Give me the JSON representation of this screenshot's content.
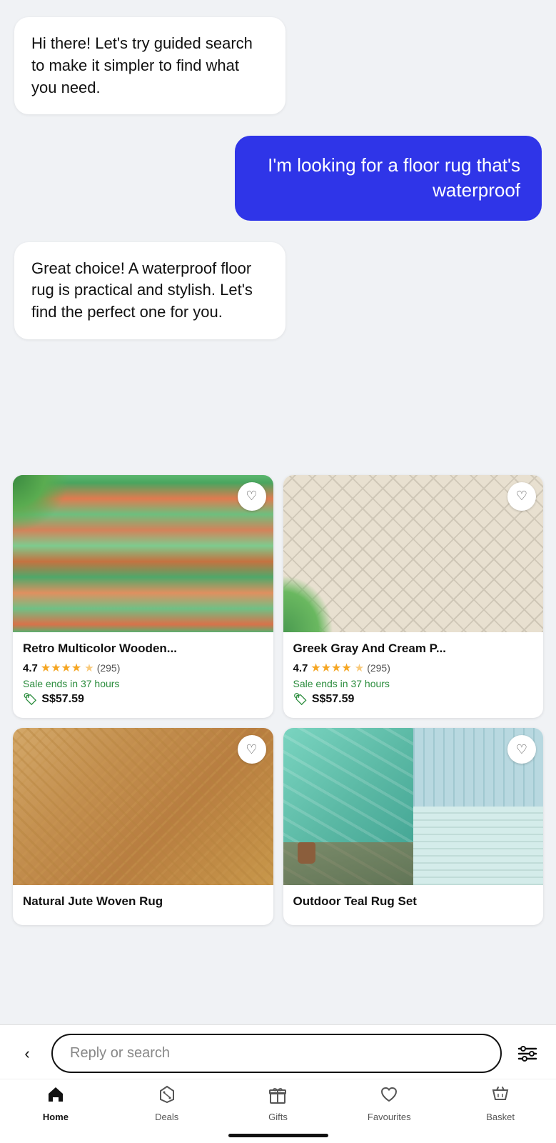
{
  "chat": {
    "bot_greeting": "Hi there! Let's try guided search to make it simpler to find what you need.",
    "user_message": "I'm looking for a floor rug that's waterproof",
    "bot_response": "Great choice! A waterproof floor rug is practical and stylish. Let's find the perfect one for you."
  },
  "products": [
    {
      "id": 1,
      "name": "Retro Multicolor Wooden...",
      "rating": "4.7",
      "reviews": "(295)",
      "sale_text": "Sale ends in 37 hours",
      "price": "S$57.59",
      "image_type": "retro"
    },
    {
      "id": 2,
      "name": "Greek Gray And Cream P...",
      "rating": "4.7",
      "reviews": "(295)",
      "sale_text": "Sale ends in 37 hours",
      "price": "S$57.59",
      "image_type": "greek"
    },
    {
      "id": 3,
      "name": "Natural Jute Woven Rug",
      "rating": "",
      "reviews": "",
      "sale_text": "",
      "price": "",
      "image_type": "jute"
    },
    {
      "id": 4,
      "name": "Outdoor Teal Rug Set",
      "rating": "",
      "reviews": "",
      "sale_text": "",
      "price": "",
      "image_type": "teal"
    }
  ],
  "search": {
    "placeholder": "Reply or search"
  },
  "nav": {
    "back_icon": "‹",
    "filter_icon": "⊟",
    "tabs": [
      {
        "id": "home",
        "label": "Home",
        "active": true
      },
      {
        "id": "deals",
        "label": "Deals",
        "active": false
      },
      {
        "id": "gifts",
        "label": "Gifts",
        "active": false
      },
      {
        "id": "favourites",
        "label": "Favourites",
        "active": false
      },
      {
        "id": "basket",
        "label": "Basket",
        "active": false
      }
    ]
  }
}
